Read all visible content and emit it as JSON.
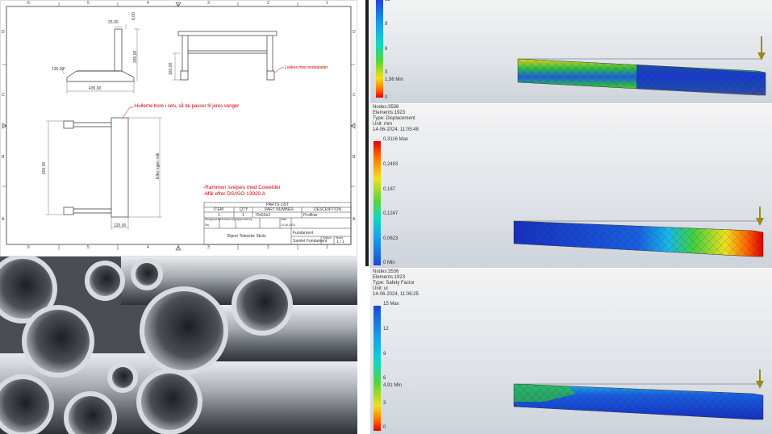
{
  "drawing": {
    "border_numbers_top": [
      "6",
      "5",
      "4",
      "3",
      "2",
      "1"
    ],
    "border_numbers_bottom": [
      "6",
      "5",
      "4",
      "3",
      "2",
      "1"
    ],
    "border_letters_left": [
      "D",
      "C",
      "B",
      "A"
    ],
    "border_letters_right": [
      "D",
      "C",
      "B",
      "A"
    ],
    "dim_25": "25,00",
    "dim_8": "8,00",
    "dim_335": "335,00",
    "dim_135": "135,00°",
    "dim_435": "435,00",
    "dim_160": "160,00",
    "note_lukkes": "Lukkes med endeplader",
    "note_hullerne": "-Hullerne bore i selv, så de passer til jeres vanger",
    "dim_600": "600,00",
    "dim_efter": "Efter egen mål",
    "dim_120": "120,00",
    "note_rammen": "-Rammen svejses med Cowelder",
    "note_maal": "-Mål efter DS/ISO 13920 A",
    "parts_list": {
      "title": "PARTS LIST",
      "headers": [
        "ITEM",
        "QTY",
        "PART NUMBER",
        "DESCRIPTION"
      ],
      "row": [
        "1",
        "1",
        "70x50x3",
        "Profilrør"
      ]
    },
    "title_block": {
      "designed_by": "Designed by",
      "checked_by": "Checked by",
      "approved_by": "Approved by",
      "date_label": "Date",
      "date": "14-06-2024",
      "designer": "Stu",
      "school": "Skjern Tekniske Skole",
      "name": "Fundament",
      "subtitle": "Samlet Fundament",
      "edition": "Edition",
      "sheet_label": "Sheet",
      "sheet": "1 / 1"
    }
  },
  "fea": [
    {
      "info": [],
      "max": "",
      "min": "1,96 Min",
      "ticks": [
        "12",
        "9",
        "6",
        "3",
        "0"
      ]
    },
    {
      "info": [
        "Nodes:3536",
        "Elements:1923",
        "Type: Displacement",
        "Unit: mm",
        "14-06-2024, 11:05:48"
      ],
      "max": "0,3116 Max",
      "min": "0 Min",
      "ticks": [
        "0,2493",
        "0,187",
        "0,1247",
        "0,0623"
      ]
    },
    {
      "info": [
        "Nodes:3536",
        "Elements:1923",
        "Type: Safety Factor",
        "Unit: ul",
        "14-06-2024, 11:06:25"
      ],
      "max": "15 Max",
      "min": "4,91 Min",
      "ticks": [
        "12",
        "9",
        "6",
        "3",
        "0"
      ]
    }
  ],
  "colors": {
    "dim_line": "#333333",
    "note_red": "#d40000",
    "arrow": "#9a8a1c"
  }
}
